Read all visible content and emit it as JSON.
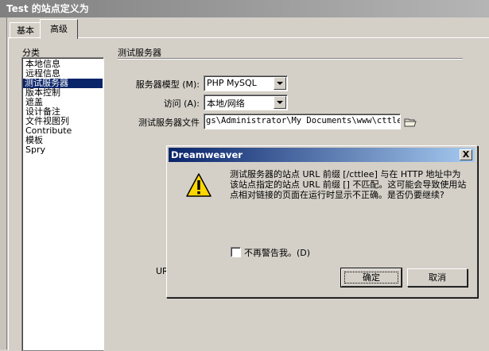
{
  "window": {
    "title": "Test 的站点定义为"
  },
  "tabs": [
    {
      "label": "基本"
    },
    {
      "label": "高级"
    }
  ],
  "category": {
    "label": "分类",
    "items": [
      {
        "label": "本地信息"
      },
      {
        "label": "远程信息"
      },
      {
        "label": "测试服务器"
      },
      {
        "label": "版本控制"
      },
      {
        "label": "遮盖"
      },
      {
        "label": "设计备注"
      },
      {
        "label": "文件视图列"
      },
      {
        "label": "Contribute"
      },
      {
        "label": "模板"
      },
      {
        "label": "Spry"
      }
    ],
    "selected_index": 2
  },
  "section": {
    "title": "测试服务器",
    "server_model_label": "服务器模型 (M):",
    "server_model_value": "PHP MySQL",
    "access_label": "访问 (A):",
    "access_value": "本地/网络",
    "folder_label": "测试服务器文件",
    "folder_value": "gs\\Administrator\\My Documents\\www\\cttlee",
    "partial_ur": "UR"
  },
  "dialog": {
    "title": "Dreamweaver",
    "close_glyph": "X",
    "message": "测试服务器的站点 URL 前缀 [/cttlee] 与在 HTTP 地址中为该站点指定的站点 URL 前缀 [] 不匹配。这可能会导致使用站点相对链接的页面在运行时显示不正确。是否仍要继续?",
    "checkbox_label": "不再警告我。(D)",
    "checkbox_checked": false,
    "ok_label": "确定",
    "cancel_label": "取消"
  },
  "colors": {
    "dialog_title_start": "#0a246a",
    "dialog_title_end": "#a6caf0",
    "selection": "#0a246a",
    "warning_yellow": "#ffd700"
  }
}
